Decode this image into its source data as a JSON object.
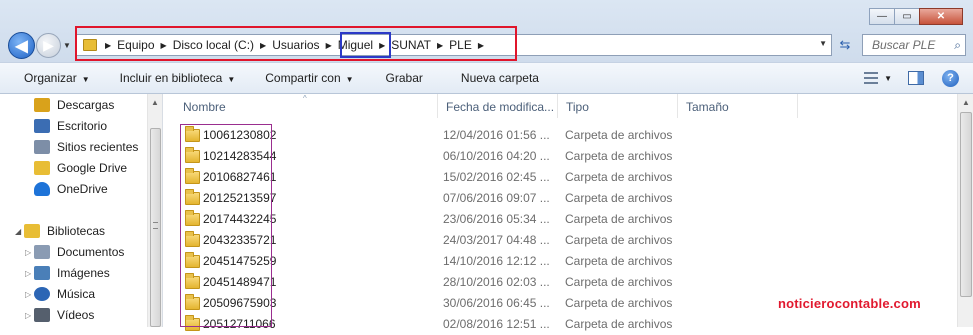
{
  "window": {
    "minimize_glyph": "—",
    "maximize_glyph": "▭",
    "close_glyph": "✕"
  },
  "nav": {
    "back_glyph": "◀",
    "forward_glyph": "▶",
    "history_glyph": "▼"
  },
  "address": {
    "crumbs": [
      "Equipo",
      "Disco local (C:)",
      "Usuarios",
      "Miguel",
      "SUNAT",
      "PLE"
    ],
    "separator": "▶",
    "dropdown_glyph": "▼",
    "refresh_glyph": "⇆"
  },
  "search": {
    "placeholder": "Buscar PLE",
    "icon_glyph": "⌕"
  },
  "toolbar": {
    "organize": "Organizar",
    "include_library": "Incluir en biblioteca",
    "share_with": "Compartir con",
    "burn": "Grabar",
    "new_folder": "Nueva carpeta",
    "caret": "▼",
    "help": "?"
  },
  "navpane": {
    "items": [
      {
        "label": "Descargas",
        "icon": "downloads-icon",
        "color": "#d9a21b"
      },
      {
        "label": "Escritorio",
        "icon": "desktop-icon",
        "color": "#3b6db3"
      },
      {
        "label": "Sitios recientes",
        "icon": "recent-places-icon",
        "color": "#7d8ea7"
      },
      {
        "label": "Google Drive",
        "icon": "google-drive-icon",
        "color": "#e8bd35"
      },
      {
        "label": "OneDrive",
        "icon": "onedrive-icon",
        "color": "#1e73d8"
      }
    ],
    "libraries": "Bibliotecas",
    "library_items": [
      {
        "label": "Documentos",
        "icon": "documents-icon",
        "color": "#8a9bb3"
      },
      {
        "label": "Imágenes",
        "icon": "pictures-icon",
        "color": "#4a7fb8"
      },
      {
        "label": "Música",
        "icon": "music-icon",
        "color": "#2c66b5"
      },
      {
        "label": "Vídeos",
        "icon": "videos-icon",
        "color": "#555f6d"
      }
    ],
    "expander": "▷"
  },
  "list": {
    "columns": [
      "Nombre",
      "Fecha de modifica...",
      "Tipo",
      "Tamaño"
    ],
    "sort_glyph": "^",
    "rows": [
      {
        "name": "10061230802",
        "date": "12/04/2016 01:56 ...",
        "type": "Carpeta de archivos"
      },
      {
        "name": "10214283544",
        "date": "06/10/2016 04:20 ...",
        "type": "Carpeta de archivos"
      },
      {
        "name": "20106827461",
        "date": "15/02/2016 02:45 ...",
        "type": "Carpeta de archivos"
      },
      {
        "name": "20125213597",
        "date": "07/06/2016 09:07 ...",
        "type": "Carpeta de archivos"
      },
      {
        "name": "20174432245",
        "date": "23/06/2016 05:34 ...",
        "type": "Carpeta de archivos"
      },
      {
        "name": "20432335721",
        "date": "24/03/2017 04:48 ...",
        "type": "Carpeta de archivos"
      },
      {
        "name": "20451475259",
        "date": "14/10/2016 12:12 ...",
        "type": "Carpeta de archivos"
      },
      {
        "name": "20451489471",
        "date": "28/10/2016 02:03 ...",
        "type": "Carpeta de archivos"
      },
      {
        "name": "20509675903",
        "date": "30/06/2016 06:45 ...",
        "type": "Carpeta de archivos"
      },
      {
        "name": "20512711066",
        "date": "02/08/2016 12:51 ...",
        "type": "Carpeta de archivos"
      }
    ]
  },
  "watermark": "noticierocontable.com",
  "colors": {
    "highlight_red": "#e0152b",
    "highlight_blue": "#2b39c7",
    "highlight_purple": "#9a2e8f",
    "watermark": "#e1192f"
  }
}
